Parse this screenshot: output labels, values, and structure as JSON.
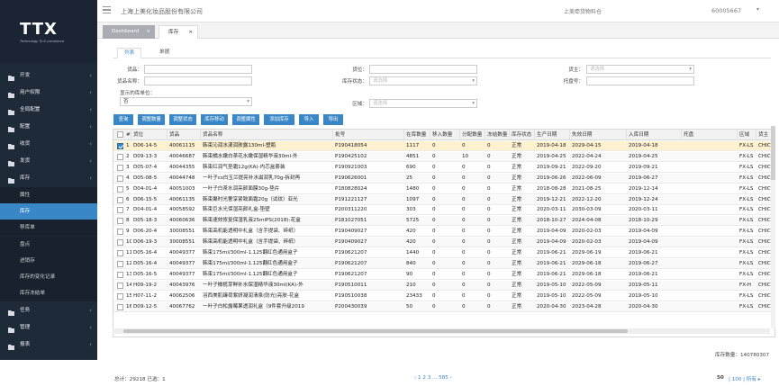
{
  "logo": {
    "text": "TTX",
    "sub": "Technology To E-commerce"
  },
  "sidebar": {
    "menus": [
      {
        "label": "开发",
        "icon": "folder-icon"
      },
      {
        "label": "用户权限",
        "icon": "folder-icon"
      },
      {
        "label": "全局配置",
        "icon": "folder-icon"
      },
      {
        "label": "配置",
        "icon": "folder-icon"
      },
      {
        "label": "收货",
        "icon": "folder-icon"
      },
      {
        "label": "发货",
        "icon": "folder-icon"
      },
      {
        "label": "库存",
        "icon": "folder-open-icon"
      }
    ],
    "subs": [
      "属性",
      "库存",
      "移库单",
      "盘点",
      "进销存",
      "库存的变化记录",
      "库存冻结单"
    ],
    "menus2": [
      {
        "label": "任务",
        "icon": "folder-icon"
      },
      {
        "label": "管理",
        "icon": "folder-icon"
      },
      {
        "label": "报表",
        "icon": "folder-icon"
      }
    ]
  },
  "topbar": {
    "company": "上海上美化妆品股份有限公司",
    "right1": "上美牵货物料仓",
    "right2": "60005667"
  },
  "pagetabs": [
    "Dashboard",
    "库存"
  ],
  "subtabs": [
    "列表",
    "单据"
  ],
  "filters": {
    "huopin": "货品：",
    "huopin_name": "货品名称：",
    "display_unit": "显示的库单位：",
    "display_unit_val": "否",
    "huowei": "货位：",
    "kucun_status": "库存状态：",
    "kucun_status_ph": "请选择",
    "quyu": "区域：",
    "quyu_ph": "请选择",
    "huozhu": "货主：",
    "huozhu_ph": "请选择",
    "tuopan": "托盘号："
  },
  "buttons": [
    "查询",
    "调整数量",
    "调整状态",
    "库存移动",
    "调整属性",
    "添加库存",
    "导入",
    "导出"
  ],
  "grid": {
    "headers": [
      "#",
      "货位",
      "货品",
      "货品名称",
      "批号",
      "在库数量",
      "移入数量",
      "分配数量",
      "冻结数量",
      "库存状态",
      "生产日期",
      "失效日期",
      "入库日期",
      "托盘",
      "区域",
      "货主"
    ],
    "rows": [
      [
        "1",
        "D06-14-5",
        "40061115",
        "韩束沁润水漾润肤露130ml-塑瓶",
        "P190418054",
        "1117",
        "0",
        "0",
        "0",
        "正常",
        "2019-04-18",
        "2029-04-15",
        "2019-04-18",
        "",
        "FX-LS",
        "CHICM"
      ],
      [
        "2",
        "D09-13-3",
        "40046687",
        "韩束橘水嫩白茶花水嫩保湿精华液30ml-外",
        "P190425102",
        "4851",
        "0",
        "10",
        "0",
        "正常",
        "2019-04-25",
        "2022-04-24",
        "2019-04-25",
        "",
        "FX-LS",
        "CHICM"
      ],
      [
        "3",
        "D05-07-4",
        "40044355",
        "韩束红润气垫霜12g(KA)-内芯盒套装",
        "P190921003",
        "690",
        "0",
        "0",
        "0",
        "正常",
        "2019-09-21",
        "2022-09-20",
        "2019-09-21",
        "",
        "FX-LS",
        "CHICM"
      ],
      [
        "4",
        "D05-08-5",
        "40044748",
        "一叶子cs白玉兰提亮补水滋润乳70g-拆封再",
        "P190626001",
        "25",
        "0",
        "0",
        "0",
        "正常",
        "2019-06-26",
        "2022-06-09",
        "2019-06-27",
        "",
        "FX-LS",
        "CHICM"
      ],
      [
        "5",
        "D04-01-4",
        "40051003",
        "一叶子白茶水润亮颜面膜30g-垫片",
        "P180828024",
        "1480",
        "0",
        "0",
        "0",
        "正常",
        "2018-08-28",
        "2021-08-25",
        "2019-12-14",
        "",
        "FX-LS",
        "CHICM"
      ],
      [
        "6",
        "D06-15-5",
        "40061135",
        "韩束聚时光奢享紧致面霜20g（试纹）亚光",
        "P191221127",
        "1097",
        "0",
        "0",
        "0",
        "正常",
        "2019-12-21",
        "2022-12-20",
        "2019-12-24",
        "",
        "FX-LS",
        "CHICM"
      ],
      [
        "7",
        "D04-01-4",
        "40058592",
        "韩束巨水光保湿亮颜礼盒-垫壁",
        "P200311220",
        "303",
        "0",
        "0",
        "0",
        "正常",
        "2020-03-11",
        "2030-03-09",
        "2020-03-11",
        "",
        "FX-LS",
        "CHICM"
      ],
      [
        "8",
        "D05-18-3",
        "40060636",
        "韩束速效修复保湿乳液25mlPS(2018)-花盒",
        "P181027051",
        "5725",
        "0",
        "0",
        "0",
        "正常",
        "2018-10-27",
        "2024-04-08",
        "2018-10-29",
        "",
        "FX-LS",
        "CHICM"
      ],
      [
        "9",
        "D06-20-4",
        "30008551",
        "韩束高机能透明中礼盒（含手提袋、碎纸）",
        "P190409027",
        "420",
        "0",
        "0",
        "0",
        "正常",
        "2019-04-09",
        "2020-02-03",
        "2019-04-09",
        "",
        "FX-LS",
        "CHICM"
      ],
      [
        "10",
        "D06-19-3",
        "30008551",
        "韩束高机能透明中礼盒（含手提袋、碎纸）",
        "P190409027",
        "420",
        "0",
        "0",
        "0",
        "正常",
        "2019-04-09",
        "2020-02-03",
        "2019-04-09",
        "",
        "FX-LS",
        "CHICM"
      ],
      [
        "11",
        "D05-16-4",
        "40049377",
        "韩束175ml/300ml-1.125翻红色通用盒子",
        "P190621207",
        "1440",
        "0",
        "0",
        "0",
        "正常",
        "2019-06-21",
        "2029-06-19",
        "2019-06-21",
        "",
        "FX-LS",
        "CHICM"
      ],
      [
        "12",
        "D05-16-4",
        "40049377",
        "韩束175ml/300ml-1.125翻红色通用盒子",
        "P190621207",
        "840",
        "0",
        "0",
        "0",
        "正常",
        "2019-06-21",
        "2029-06-18",
        "2019-06-27",
        "",
        "FX-LS",
        "CHICM"
      ],
      [
        "13",
        "D05-16-5",
        "40049377",
        "韩束175ml/300ml-1.125翻红色通用盒子",
        "P190621207",
        "90",
        "0",
        "0",
        "0",
        "正常",
        "2019-06-21",
        "2029-06-18",
        "2019-06-21",
        "",
        "FX-LS",
        "CHICM"
      ],
      [
        "14",
        "H09-19-2",
        "40043976",
        "一叶子橄榄芽鲜补水保湿精华液30ml(KA)-外",
        "P190510011",
        "210",
        "0",
        "0",
        "0",
        "正常",
        "2019-05-10",
        "2022-05-09",
        "2019-05-11",
        "",
        "FX-H",
        "CHICM"
      ],
      [
        "15",
        "H07-11-2",
        "40062506",
        "羽西美肌臻荷紫妍凝润清泉(防光)亮肤-花盒",
        "P190510038",
        "23433",
        "0",
        "0",
        "0",
        "正常",
        "2019-05-10",
        "2022-05-09",
        "2019-05-10",
        "",
        "FX-LS",
        "CHICM"
      ],
      [
        "16",
        "D09-12-5",
        "40067762",
        "一叶子白松露莓果透润礼盒（9件套升级2019",
        "P200430039",
        "50",
        "0",
        "0",
        "0",
        "正常",
        "2020-04-30",
        "2023-04-28",
        "2020-04-30",
        "",
        "FX-LS",
        "CHICM"
      ]
    ]
  },
  "footer": {
    "total": "总计：29218 已选：1",
    "pager": "‹ 1 2 3 ... 585 ›",
    "pagesize": "50",
    "pagesize_options": "| 100 | 所有 ▸",
    "sum": "库存数量：140780307"
  }
}
